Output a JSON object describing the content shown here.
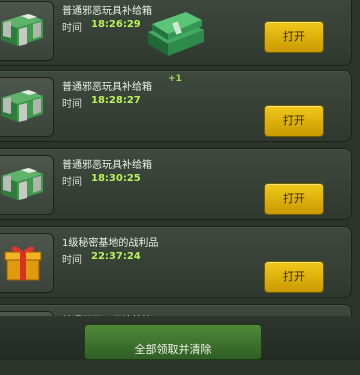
{
  "items": [
    {
      "title": "普通邪恶玩具补给箱",
      "time_label": "时间",
      "time": "18:26:29",
      "button": "打开",
      "icon": "green-crate-icon"
    },
    {
      "title": "普通邪恶玩具补给箱",
      "time_label": "时间",
      "time": "18:28:27",
      "button": "打开",
      "icon": "green-crate-icon"
    },
    {
      "title": "普通邪恶玩具补给箱",
      "time_label": "时间",
      "time": "18:30:25",
      "button": "打开",
      "icon": "green-crate-icon"
    },
    {
      "title": "1级秘密基地的战利品",
      "time_label": "时间",
      "time": "22:37:24",
      "button": "打开",
      "icon": "gift-box-icon"
    },
    {
      "title": "普通邪恶玩具补给箱",
      "icon": "green-crate-icon"
    }
  ],
  "reward_popup": {
    "text": "+1",
    "icon": "cash-stack-icon"
  },
  "footer": {
    "claim_all_button": "全部领取并清除"
  },
  "colors": {
    "open_button": "#e0b40c",
    "claim_button": "#3f7430",
    "time_value": "#b9f25a"
  }
}
